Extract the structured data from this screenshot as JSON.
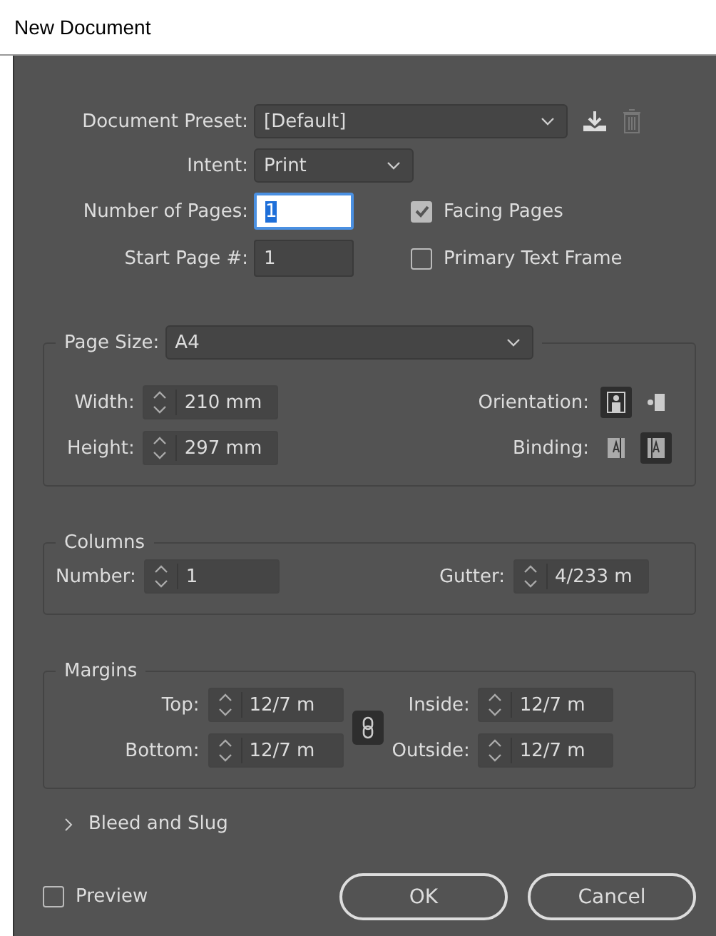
{
  "window": {
    "title": "New Document"
  },
  "document_preset": {
    "label": "Document Preset:",
    "value": "[Default]"
  },
  "intent": {
    "label": "Intent:",
    "value": "Print"
  },
  "number_of_pages": {
    "label": "Number of Pages:",
    "value": "1"
  },
  "start_page": {
    "label": "Start Page #:",
    "value": "1"
  },
  "facing_pages": {
    "label": "Facing Pages",
    "checked": true
  },
  "primary_text_frame": {
    "label": "Primary Text Frame",
    "checked": false
  },
  "page_size": {
    "label": "Page Size:",
    "value": "A4",
    "width": {
      "label": "Width:",
      "value": "210 mm"
    },
    "height": {
      "label": "Height:",
      "value": "297 mm"
    },
    "orientation": {
      "label": "Orientation:",
      "options": [
        {
          "kind": "portrait",
          "selected": true
        },
        {
          "kind": "landscape",
          "selected": false
        }
      ]
    },
    "binding": {
      "label": "Binding:",
      "options": [
        {
          "kind": "left",
          "selected": false
        },
        {
          "kind": "right",
          "selected": true
        }
      ]
    }
  },
  "columns": {
    "title": "Columns",
    "number": {
      "label": "Number:",
      "value": "1"
    },
    "gutter": {
      "label": "Gutter:",
      "value": "4/233 m"
    }
  },
  "margins": {
    "title": "Margins",
    "linked": true,
    "top": {
      "label": "Top:",
      "value": "12/7 m"
    },
    "bottom": {
      "label": "Bottom:",
      "value": "12/7 m"
    },
    "inside": {
      "label": "Inside:",
      "value": "12/7 m"
    },
    "outside": {
      "label": "Outside:",
      "value": "12/7 m"
    }
  },
  "bleed_and_slug": {
    "label": "Bleed and Slug",
    "expanded": false
  },
  "preview": {
    "label": "Preview",
    "checked": false
  },
  "buttons": [
    "OK",
    "Cancel"
  ]
}
